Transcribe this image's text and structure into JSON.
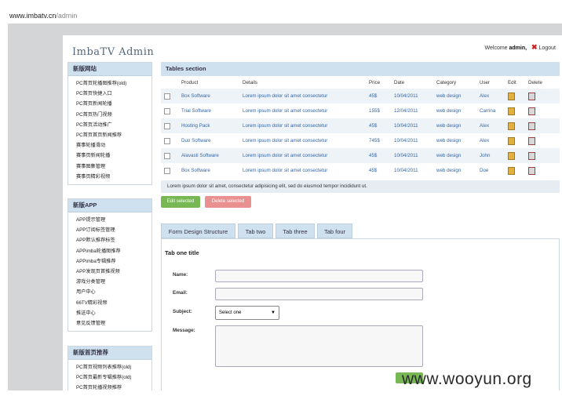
{
  "browser": {
    "url_host": "www.imbatv.cn",
    "url_path": "/admin"
  },
  "header": {
    "logo": "ImbaTV Admin",
    "welcome_label": "Welcome",
    "username": "admin,",
    "logout_label": "Logout"
  },
  "sidebar": {
    "sections": [
      {
        "title": "新版网站",
        "items": [
          "PC首页轮播图推荐(old)",
          "PC首页快捷入口",
          "PC首页新闻轮播",
          "PC首页热门视频",
          "PC首页活动推广",
          "PC首页首页新闻推荐",
          "赛事轮播滑动",
          "赛事页新闻轮播",
          "赛事图集管理",
          "赛事页精彩视频"
        ]
      },
      {
        "title": "新版APP",
        "items": [
          "APP提示管理",
          "APP订阅标签管理",
          "APP默认推荐标签",
          "APPimba轮播图推荐",
          "APPimba专辑推荐",
          "APP发现页首推视频",
          "游戏分类管理",
          "用户中心",
          "66TV精彩视频",
          "推送中心",
          "意见反馈管理"
        ]
      },
      {
        "title": "新版首页推荐",
        "items": [
          "PC首页视频列表推荐(old)",
          "PC首页最新专辑推荐(old)",
          "PC首页轮播视频推荐"
        ]
      }
    ]
  },
  "tables": {
    "title": "Tables section",
    "columns": [
      "Product",
      "Details",
      "Price",
      "Date",
      "Category",
      "User",
      "Edit",
      "Delete"
    ],
    "rows": [
      {
        "product": "Box Software",
        "details": "Lorem ipsum dolor sit amet consectetur",
        "price": "45$",
        "date": "10/04/2011",
        "category": "web design",
        "user": "Alex"
      },
      {
        "product": "Trial Software",
        "details": "Lorem ipsum dolor sit amet consectetur",
        "price": "155$",
        "date": "12/04/2011",
        "category": "web design",
        "user": "Carrina"
      },
      {
        "product": "Hosting Pack",
        "details": "Lorem ipsum dolor sit amet consectetur",
        "price": "45$",
        "date": "10/04/2011",
        "category": "web design",
        "user": "Alex"
      },
      {
        "product": "Duo Software",
        "details": "Lorem ipsum dolor sit amet consectetur",
        "price": "745$",
        "date": "10/04/2011",
        "category": "web design",
        "user": "Alex"
      },
      {
        "product": "Alavasti Software",
        "details": "Lorem ipsum dolor sit amet consectetur",
        "price": "45$",
        "date": "10/04/2011",
        "category": "web design",
        "user": "John"
      },
      {
        "product": "Box Software",
        "details": "Lorem ipsum dolor sit amet consectetur",
        "price": "45$",
        "date": "10/04/2011",
        "category": "web design",
        "user": "Doe"
      }
    ],
    "footnote": "Lorem ipsum dolor sit amet, consectetur adipisicing elit, sed do eiusmod tempor incididunt ut.",
    "edit_selected": "Edit selected",
    "delete_selected": "Delete selected"
  },
  "form": {
    "tabs": [
      "Form Design Structure",
      "Tab two",
      "Tab three",
      "Tab four"
    ],
    "title": "Tab one title",
    "name_label": "Name:",
    "email_label": "Email:",
    "subject_label": "Subject:",
    "subject_value": "Select one",
    "message_label": "Message:"
  },
  "watermark": "www.wooyun.org",
  "colors": {
    "header_bar": "#cfe0ee",
    "green_button": "#77b855",
    "red_button": "#e99090",
    "link": "#3366aa"
  }
}
